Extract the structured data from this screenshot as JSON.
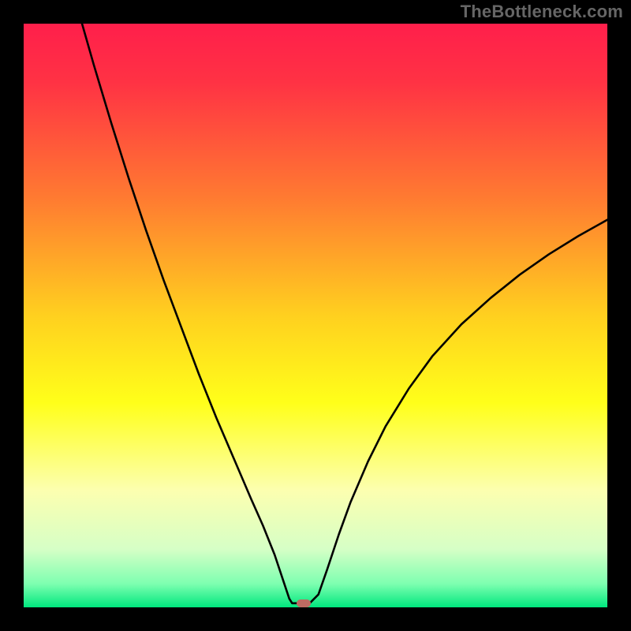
{
  "watermark": "TheBottleneck.com",
  "chart_data": {
    "type": "line",
    "title": "",
    "xlabel": "",
    "ylabel": "",
    "xlim": [
      0,
      100
    ],
    "ylim": [
      0,
      100
    ],
    "background_gradient": {
      "stops": [
        {
          "offset": 0.0,
          "color": "#ff1f4b"
        },
        {
          "offset": 0.1,
          "color": "#ff3244"
        },
        {
          "offset": 0.3,
          "color": "#ff7b31"
        },
        {
          "offset": 0.5,
          "color": "#ffd01f"
        },
        {
          "offset": 0.65,
          "color": "#ffff1a"
        },
        {
          "offset": 0.8,
          "color": "#fcffb0"
        },
        {
          "offset": 0.9,
          "color": "#d6ffc6"
        },
        {
          "offset": 0.96,
          "color": "#7dffb0"
        },
        {
          "offset": 1.0,
          "color": "#00e77e"
        }
      ]
    },
    "series": [
      {
        "name": "curve",
        "points": [
          {
            "x": 10.0,
            "y": 100.0
          },
          {
            "x": 12.0,
            "y": 93.0
          },
          {
            "x": 15.0,
            "y": 83.0
          },
          {
            "x": 18.0,
            "y": 73.5
          },
          {
            "x": 21.0,
            "y": 64.5
          },
          {
            "x": 24.0,
            "y": 56.0
          },
          {
            "x": 27.0,
            "y": 48.0
          },
          {
            "x": 30.0,
            "y": 40.0
          },
          {
            "x": 33.0,
            "y": 32.5
          },
          {
            "x": 36.0,
            "y": 25.5
          },
          {
            "x": 39.0,
            "y": 18.5
          },
          {
            "x": 41.0,
            "y": 14.0
          },
          {
            "x": 43.0,
            "y": 9.0
          },
          {
            "x": 44.5,
            "y": 4.5
          },
          {
            "x": 45.5,
            "y": 1.5
          },
          {
            "x": 46.0,
            "y": 0.7
          },
          {
            "x": 47.5,
            "y": 0.7
          },
          {
            "x": 49.0,
            "y": 0.7
          },
          {
            "x": 50.5,
            "y": 2.2
          },
          {
            "x": 52.0,
            "y": 6.5
          },
          {
            "x": 54.0,
            "y": 12.5
          },
          {
            "x": 56.0,
            "y": 18.0
          },
          {
            "x": 59.0,
            "y": 25.0
          },
          {
            "x": 62.0,
            "y": 31.0
          },
          {
            "x": 66.0,
            "y": 37.5
          },
          {
            "x": 70.0,
            "y": 43.0
          },
          {
            "x": 75.0,
            "y": 48.5
          },
          {
            "x": 80.0,
            "y": 53.0
          },
          {
            "x": 85.0,
            "y": 57.0
          },
          {
            "x": 90.0,
            "y": 60.5
          },
          {
            "x": 95.0,
            "y": 63.6
          },
          {
            "x": 100.0,
            "y": 66.4
          }
        ]
      }
    ],
    "marker": {
      "x": 48.0,
      "y": 0.7,
      "color": "#bd6b62"
    }
  }
}
